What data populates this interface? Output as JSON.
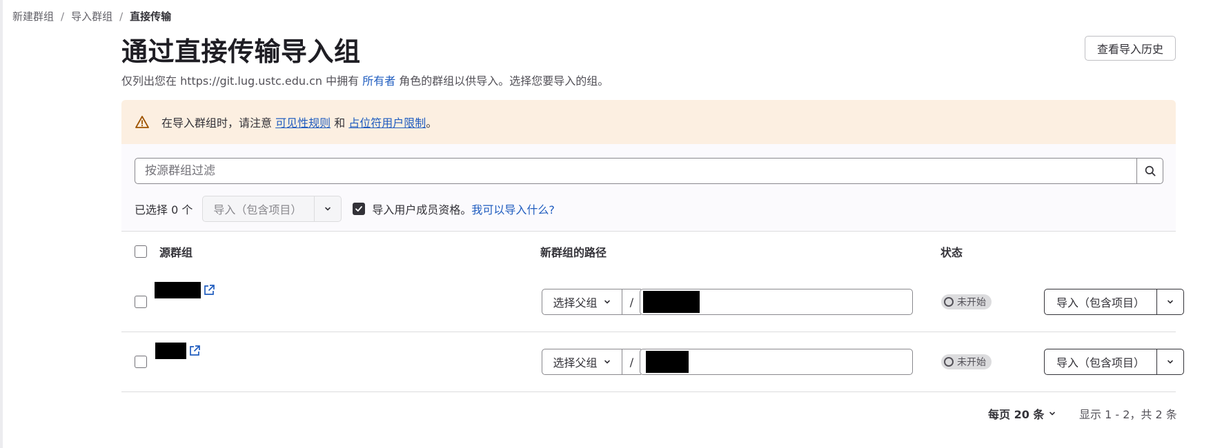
{
  "breadcrumb": {
    "items": [
      "新建群组",
      "导入群组"
    ],
    "current": "直接传输",
    "separator": "/"
  },
  "header": {
    "title": "通过直接传输导入组",
    "history_button": "查看导入历史",
    "subtitle_pre": "仅列出您在 https://git.lug.ustc.edu.cn 中拥有 ",
    "subtitle_link": "所有者",
    "subtitle_post": " 角色的群组以供导入。选择您要导入的组。"
  },
  "alert": {
    "icon": "warning-icon",
    "text_pre": "在导入群组时，请注意 ",
    "link1": "可见性规则",
    "text_mid": " 和 ",
    "link2": "占位符用户限制",
    "text_post": "。",
    "color": "#fcefe1"
  },
  "filter": {
    "search_placeholder": "按源群组过滤",
    "selected_count": "已选择 0 个",
    "bulk_import_label": "导入（包含项目）",
    "import_memberships_label": "导入用户成员资格。",
    "import_memberships_checked": true,
    "what_can_import_link": "我可以导入什么?"
  },
  "table": {
    "columns": [
      "源群组",
      "新群组的路径",
      "状态"
    ],
    "rows": [
      {
        "parent_select": "选择父组",
        "path_separator": "/",
        "status": "未开始",
        "import_button": "导入（包含项目）"
      },
      {
        "parent_select": "选择父组",
        "path_separator": "/",
        "status": "未开始",
        "import_button": "导入（包含项目）"
      }
    ]
  },
  "pagination": {
    "per_page": "每页 20 条",
    "range": "显示 1 - 2，共 2 条"
  },
  "colors": {
    "link": "#1f5cbf",
    "alert_bg": "#fcefe1",
    "text": "#333238"
  }
}
